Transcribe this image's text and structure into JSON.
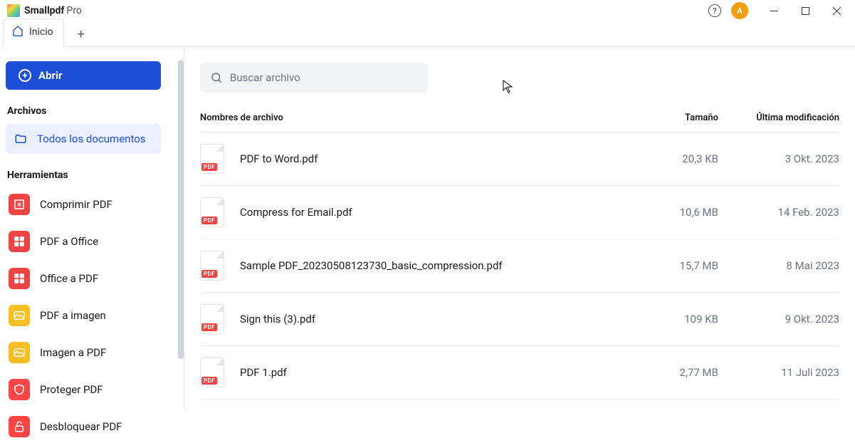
{
  "titlebar": {
    "app_name": "Smallpdf",
    "tier": "Pro",
    "avatar_letter": "A",
    "help_symbol": "?"
  },
  "tabs": {
    "home_label": "Inicio"
  },
  "sidebar": {
    "open_label": "Abrir",
    "archives_title": "Archivos",
    "all_docs_label": "Todos los documentos",
    "tools_title": "Herramientas",
    "tools": [
      {
        "label": "Comprimir PDF"
      },
      {
        "label": "PDF a Office"
      },
      {
        "label": "Office a PDF"
      },
      {
        "label": "PDF a imagen"
      },
      {
        "label": "Imagen a PDF"
      },
      {
        "label": "Proteger PDF"
      },
      {
        "label": "Desbloquear PDF"
      }
    ]
  },
  "search": {
    "placeholder": "Buscar archivo"
  },
  "table": {
    "headers": {
      "name": "Nombres de archivo",
      "size": "Tamaño",
      "date": "Última modificación"
    },
    "rows": [
      {
        "name": "PDF to Word.pdf",
        "size": "20,3 KB",
        "date": "3 Okt. 2023"
      },
      {
        "name": "Compress for Email.pdf",
        "size": "10,6 MB",
        "date": "14 Feb. 2023"
      },
      {
        "name": "Sample PDF_20230508123730_basic_compression.pdf",
        "size": "15,7 MB",
        "date": "8 Mai 2023"
      },
      {
        "name": "Sign this (3).pdf",
        "size": "109 KB",
        "date": "9 Okt. 2023"
      },
      {
        "name": "PDF 1.pdf",
        "size": "2,77 MB",
        "date": "11 Juli 2023"
      }
    ]
  },
  "pdf_badge": "PDF"
}
